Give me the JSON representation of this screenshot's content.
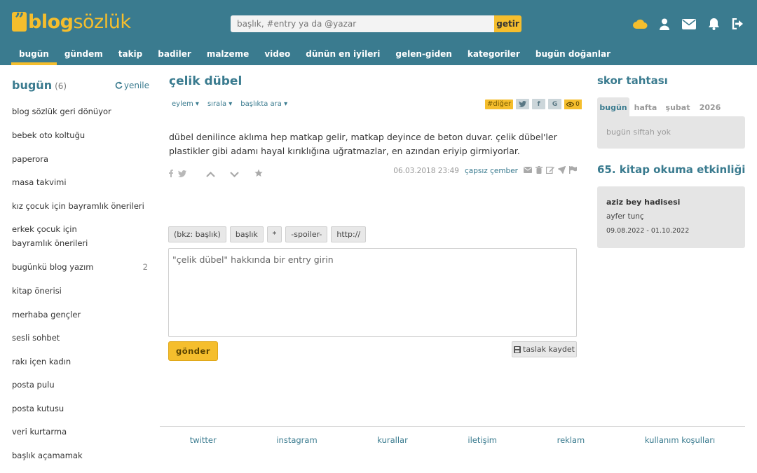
{
  "brand": {
    "name_bold": "blog",
    "name_light": "sözlük",
    "accent": "#f5be2d",
    "primary": "#3a7b8f"
  },
  "search": {
    "placeholder": "başlık, #entry ya da @yazar",
    "button": "getir"
  },
  "top_icons": [
    "cloud-icon",
    "user-icon",
    "envelope-icon",
    "bell-icon",
    "logout-icon"
  ],
  "nav": [
    "bugün",
    "gündem",
    "takip",
    "badiler",
    "malzeme",
    "video",
    "dünün en iyileri",
    "gelen-giden",
    "kategoriler",
    "bugün doğanlar"
  ],
  "left": {
    "title": "bugün",
    "count": "(6)",
    "refresh": "yenile",
    "items": [
      {
        "label": "blog sözlük geri dönüyor",
        "count": ""
      },
      {
        "label": "bebek oto koltuğu",
        "count": ""
      },
      {
        "label": "paperora",
        "count": ""
      },
      {
        "label": "masa takvimi",
        "count": ""
      },
      {
        "label": "kız çocuk için bayramlık önerileri",
        "count": ""
      },
      {
        "label": "erkek çocuk için bayramlık önerileri",
        "count": ""
      },
      {
        "label": "bugünkü blog yazım",
        "count": "2"
      },
      {
        "label": "kitap önerisi",
        "count": ""
      },
      {
        "label": "merhaba gençler",
        "count": ""
      },
      {
        "label": "sesli sohbet",
        "count": ""
      },
      {
        "label": "rakı içen kadın",
        "count": ""
      },
      {
        "label": "posta pulu",
        "count": ""
      },
      {
        "label": "posta kutusu",
        "count": ""
      },
      {
        "label": "veri kurtarma",
        "count": ""
      },
      {
        "label": "başlık açamamak",
        "count": ""
      }
    ]
  },
  "topic": {
    "title": "çelik dübel",
    "menus": [
      "eylem ▾",
      "sırala ▾",
      "başlıkta ara ▾"
    ],
    "tag": "#diğer",
    "share": [
      "t",
      "f",
      "G"
    ],
    "views": "0"
  },
  "entry": {
    "text": "dübel denilince aklıma hep matkap gelir, matkap deyince de beton duvar. çelik dübel'ler plastikler gibi adamı hayal kırıklığına uğratmazlar, en azından eriyip girmiyorlar.",
    "date": "06.03.2018 23:49",
    "author": "çapsız çember"
  },
  "editor": {
    "tools": [
      "(bkz: başlık)",
      "başlık",
      "*",
      "-spoiler-",
      "http://"
    ],
    "placeholder": "\"çelik dübel\" hakkında bir entry girin",
    "send": "gönder",
    "draft": "taslak kaydet"
  },
  "right": {
    "score_title": "skor tahtası",
    "tabs": [
      "bugün",
      "hafta",
      "şubat",
      "2026"
    ],
    "score_empty": "bugün siftah yok",
    "event_title": "65. kitap okuma etkinliği",
    "event": {
      "name": "aziz bey hadisesi",
      "author": "ayfer tunç",
      "dates": "09.08.2022 - 01.10.2022"
    }
  },
  "footer": [
    "twitter",
    "instagram",
    "kurallar",
    "iletişim",
    "reklam",
    "kullanım koşulları"
  ]
}
